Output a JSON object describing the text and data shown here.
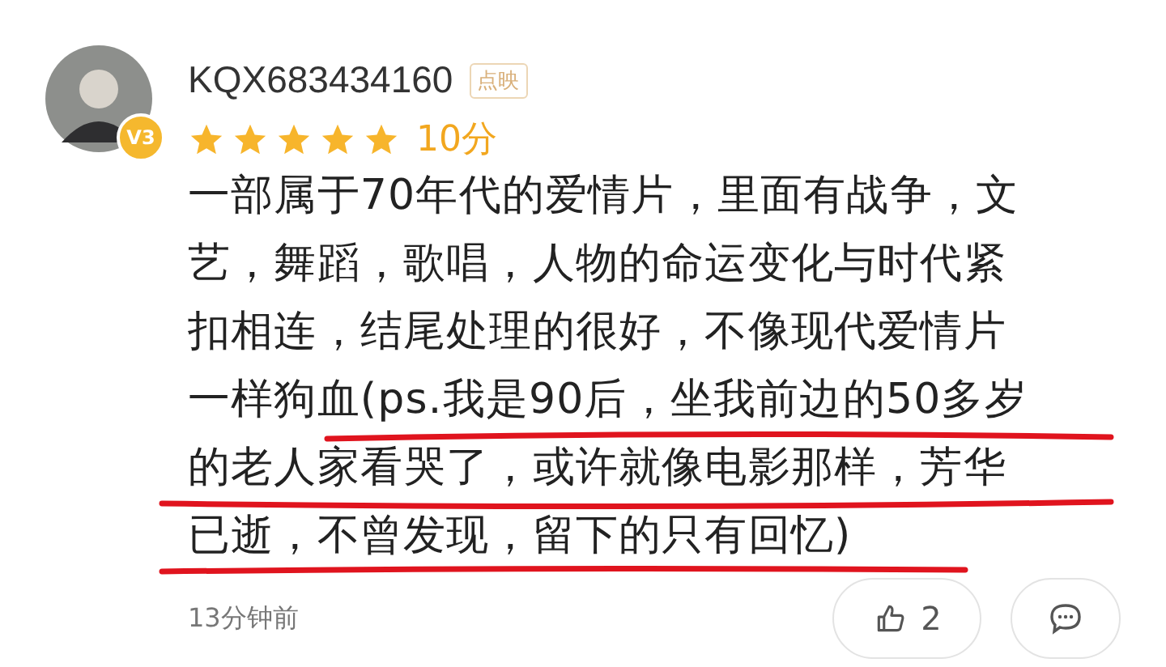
{
  "user": {
    "name": "KQX683434160",
    "level_badge": "V3",
    "tag": "点映"
  },
  "rating": {
    "stars": 5,
    "score": "10分"
  },
  "review_lines": [
    "一部属于70年代的爱情片，里面有战争，文",
    "艺，舞蹈，歌唱，人物的命运变化与时代紧",
    "扣相连，结尾处理的很好，不像现代爱情片",
    "一样狗血(ps.我是90后，坐我前边的50多岁",
    "的老人家看哭了，或许就像电影那样，芳华",
    "已逝，不曾发现，留下的只有回忆)"
  ],
  "time": "13分钟前",
  "like_count": "2"
}
